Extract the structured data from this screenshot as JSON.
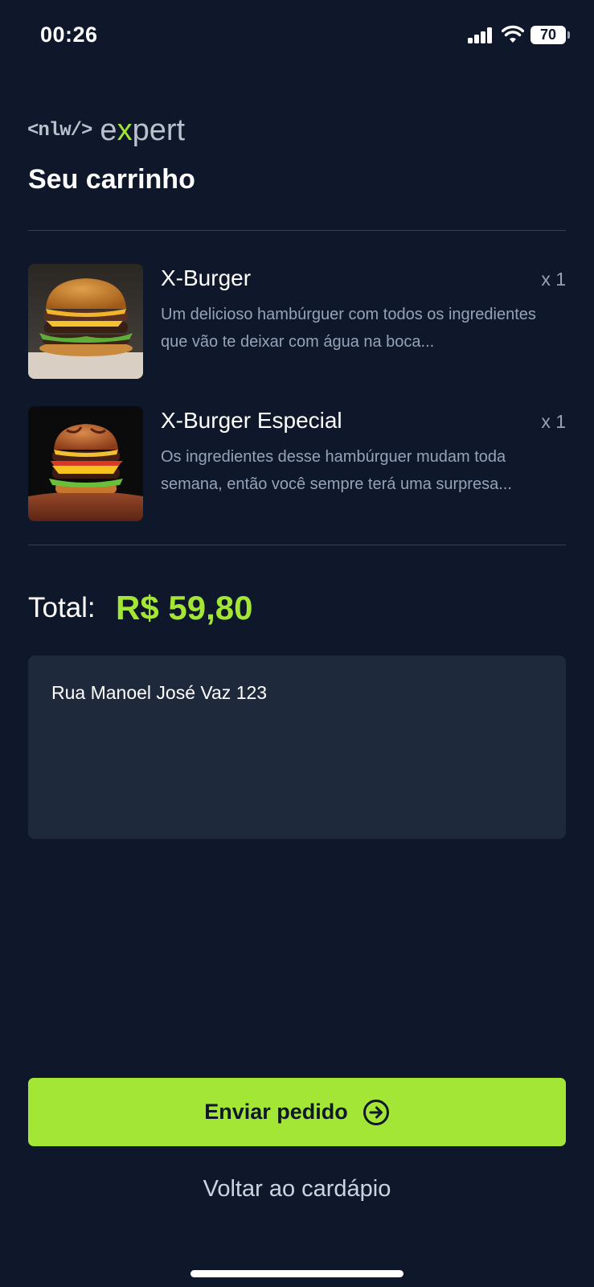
{
  "status_bar": {
    "time": "00:26",
    "battery": "70",
    "icons": [
      "cellular-signal-icon",
      "wifi-icon",
      "battery-icon"
    ]
  },
  "header": {
    "logo_left": "<nlw/>",
    "logo_right_start": "e",
    "logo_right_x": "x",
    "logo_right_end": "pert",
    "title": "Seu carrinho"
  },
  "cart": {
    "items": [
      {
        "name": "X-Burger",
        "quantity": "x 1",
        "description": "Um delicioso hambúrguer com todos os ingredientes que vão te deixar com água na boca..."
      },
      {
        "name": "X-Burger Especial",
        "quantity": "x 1",
        "description": "Os ingredientes desse hambúrguer mudam toda semana, então você sempre terá uma surpresa..."
      }
    ]
  },
  "total": {
    "label": "Total:",
    "value": "R$ 59,80"
  },
  "address": {
    "value": "Rua Manoel José Vaz 123"
  },
  "actions": {
    "send_label": "Enviar pedido",
    "back_label": "Voltar ao cardápio"
  },
  "colors": {
    "background": "#0f172a",
    "accent": "#a3e635",
    "input_bg": "#1e293b",
    "muted_text": "#94a3b8"
  }
}
